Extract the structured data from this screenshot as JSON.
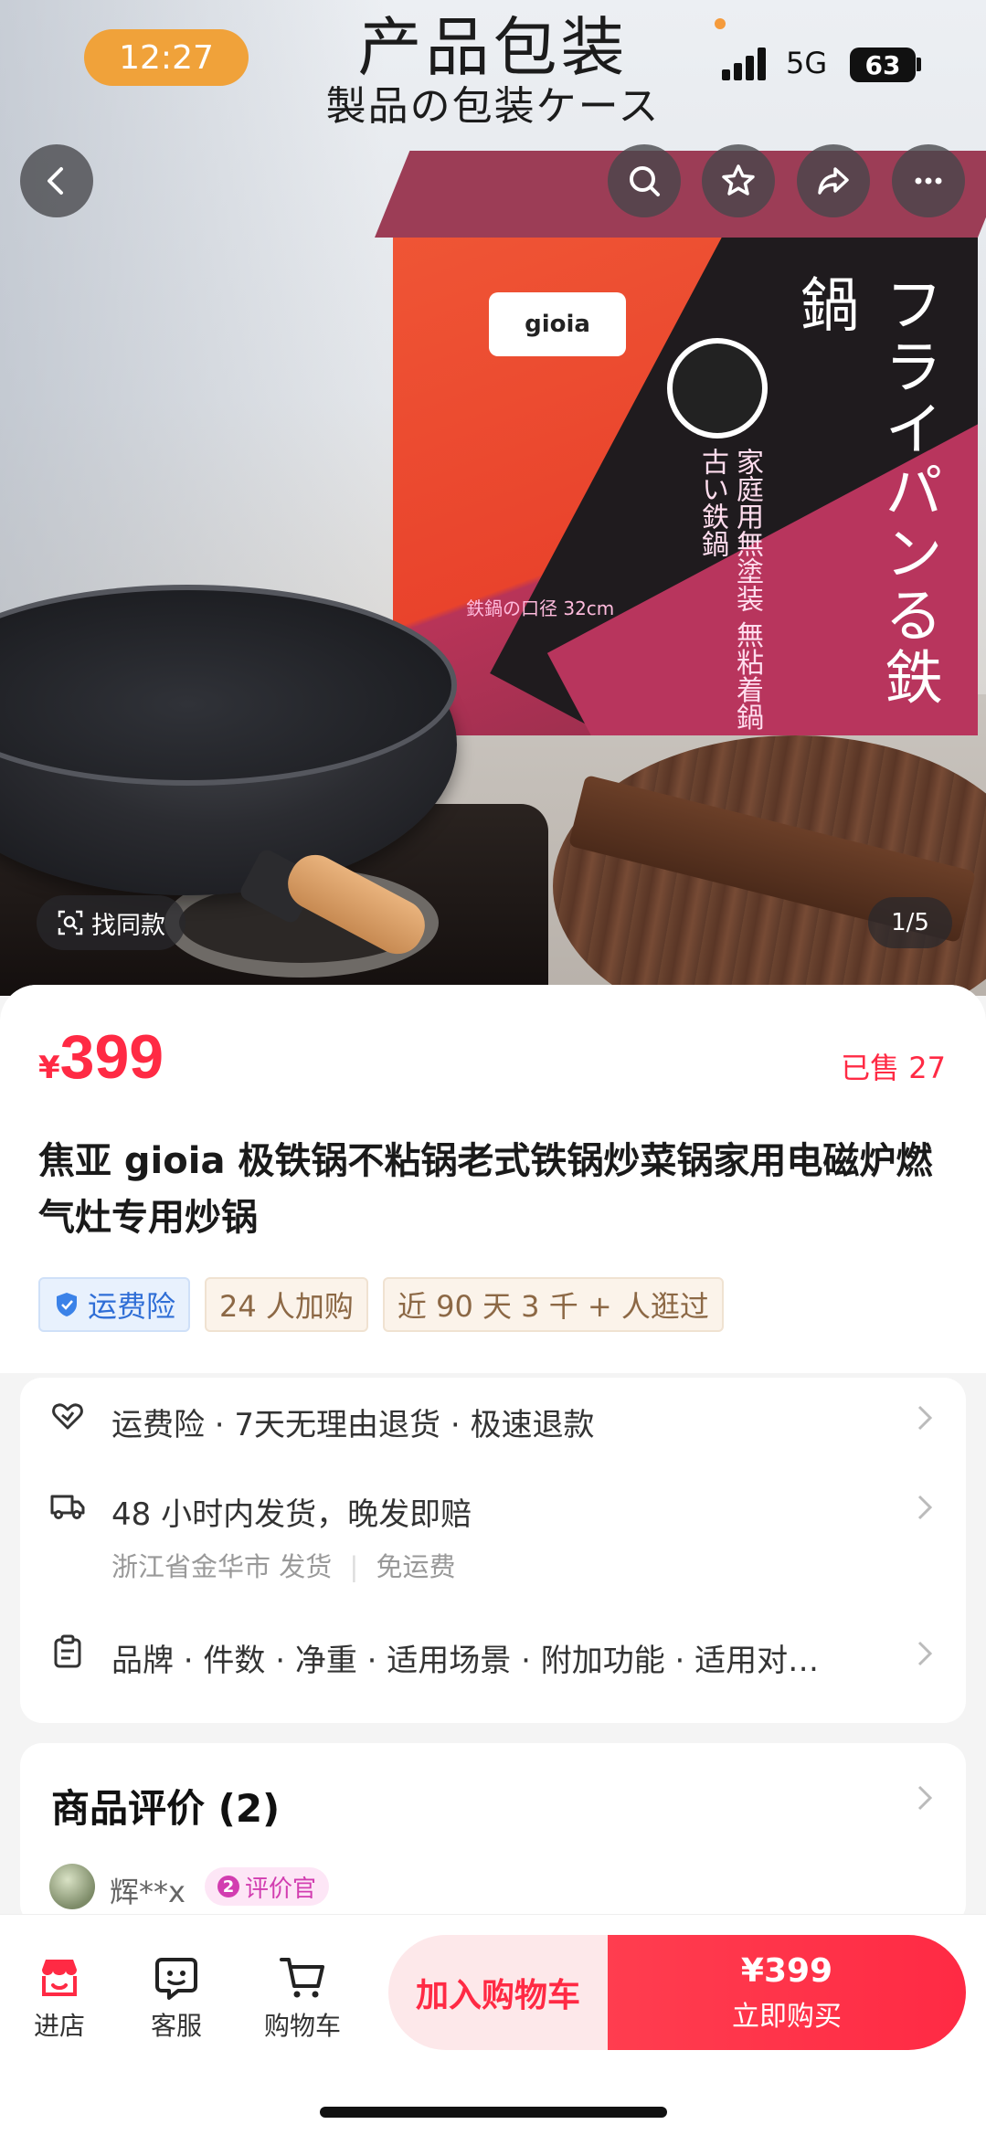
{
  "status_bar": {
    "time": "12:27",
    "network": "5G",
    "battery": "63"
  },
  "hero": {
    "caption_cn": "产品包装",
    "caption_jp": "製品の包装ケース",
    "box_brand": "gioia",
    "box_title_jp": "フライパンる鉄鍋",
    "box_sub_jp": "家庭用無塗装 無粘着鍋古い鉄鍋",
    "box_size": "鉄鍋の口径 32cm",
    "find_same_label": "找同款",
    "pager": "1/5"
  },
  "product": {
    "currency": "¥",
    "price": "399",
    "sold": "已售 27",
    "title": "焦亚 gioia 极铁锅不粘锅老式铁锅炒菜锅家用电磁炉燃气灶专用炒锅",
    "tags": [
      "运费险",
      "24 人加购",
      "近 90 天 3 千 + 人逛过"
    ]
  },
  "services": {
    "guarantee": "运费险 · 7天无理由退货 · 极速退款",
    "shipping": "48 小时内发货，晚发即赔",
    "shipping_from": "浙江省金华市 发货",
    "shipping_fee": "免运费",
    "params": "品牌 · 件数 · 净重 · 适用场景 · 附加功能 · 适用对…"
  },
  "reviews": {
    "title": "商品评价 (2)",
    "reviewer": "辉**x",
    "badge_level": "2",
    "badge_label": "评价官"
  },
  "bottom_bar": {
    "store": "进店",
    "service": "客服",
    "cart": "购物车",
    "add_to_cart": "加入购物车",
    "buy_price": "¥399",
    "buy_now": "立即购买"
  },
  "colors": {
    "accent": "#ff2a44",
    "time_pill": "#f0a23a",
    "tag_blue": "#2f6ed6",
    "badge_pink": "#d23db0"
  },
  "icons": [
    "back-icon",
    "search-icon",
    "star-icon",
    "share-icon",
    "more-icon",
    "shield-icon",
    "heart-return-icon",
    "truck-icon",
    "clipboard-icon",
    "chevron-right-icon",
    "store-icon",
    "chat-icon",
    "cart-icon",
    "lens-icon"
  ]
}
